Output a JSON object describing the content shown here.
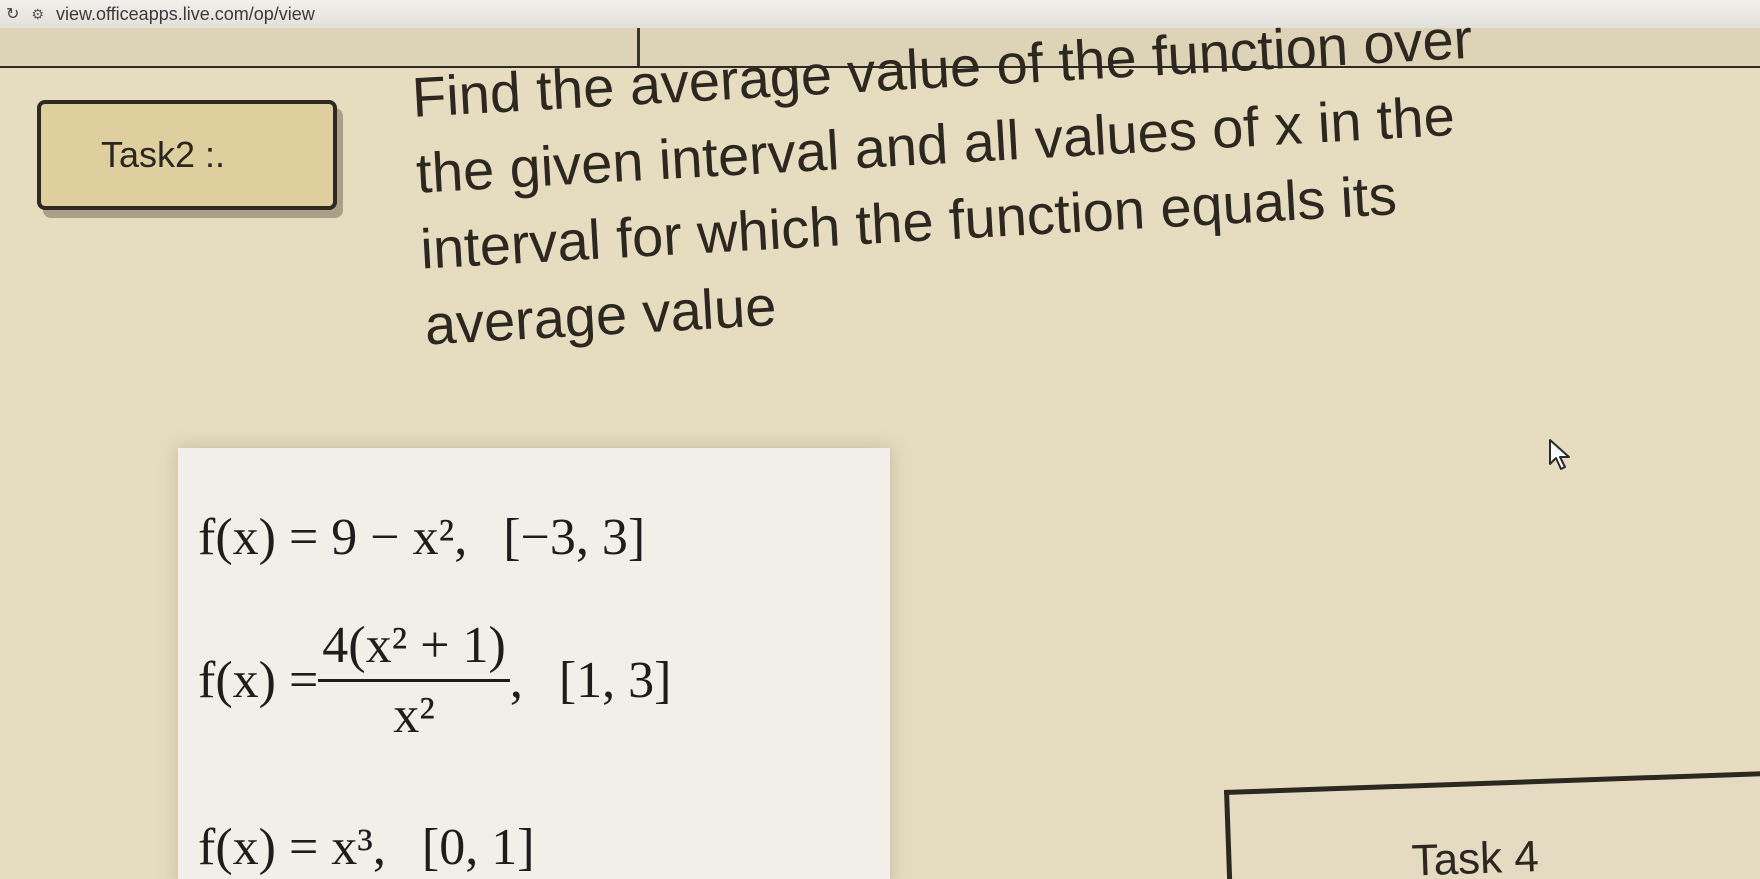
{
  "browser": {
    "url": "view.officeapps.live.com/op/view"
  },
  "slide": {
    "task_label": "Task2 :.",
    "question_lines": [
      "Find the average value of the function over",
      "the given interval and all values of x in the",
      "interval for which the function equals its",
      "average value"
    ],
    "formulas": {
      "f1": {
        "lhs": "f(x) = 9 − x², ",
        "interval": "[−3, 3]"
      },
      "f2": {
        "lhs": "f(x) = ",
        "numerator": "4(x² + 1)",
        "denominator": "x²",
        "comma": ",",
        "interval": "[1, 3]"
      },
      "f3": {
        "lhs": "f(x) = x³, ",
        "interval": "[0, 1]"
      }
    },
    "next_task_label": "Task 4"
  }
}
